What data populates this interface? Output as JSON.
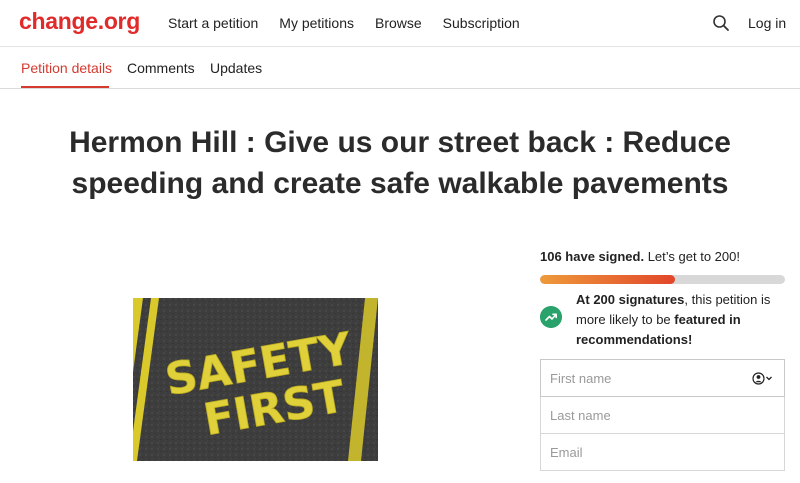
{
  "header": {
    "logo": "change.org",
    "nav": [
      "Start a petition",
      "My petitions",
      "Browse",
      "Subscription"
    ],
    "login": "Log in",
    "icons": {
      "search": "search-icon"
    }
  },
  "tabs": [
    "Petition details",
    "Comments",
    "Updates"
  ],
  "active_tab": "Petition details",
  "petition": {
    "title": "Hermon Hill : Give us our street back : Reduce speeding and create safe walkable pavements",
    "image_text": [
      "SAFETY",
      "FIRST"
    ]
  },
  "signatures": {
    "count_text": "106 have signed.",
    "goal_text": "Let’s get to 200!",
    "progress": 0.55,
    "milestone_pre": "At 200 signatures",
    "milestone_mid": ", this petition is more likely to be ",
    "milestone_bold": "featured in recommendations!"
  },
  "form": {
    "first_name_placeholder": "First name",
    "last_name_placeholder": "Last name",
    "email_placeholder": "Email"
  },
  "colors": {
    "brand": "#e12a2a",
    "active_tab": "#d43a2f",
    "progress_start": "#ee9a3b",
    "progress_end": "#e2462a",
    "milestone_icon": "#2aa26b"
  }
}
